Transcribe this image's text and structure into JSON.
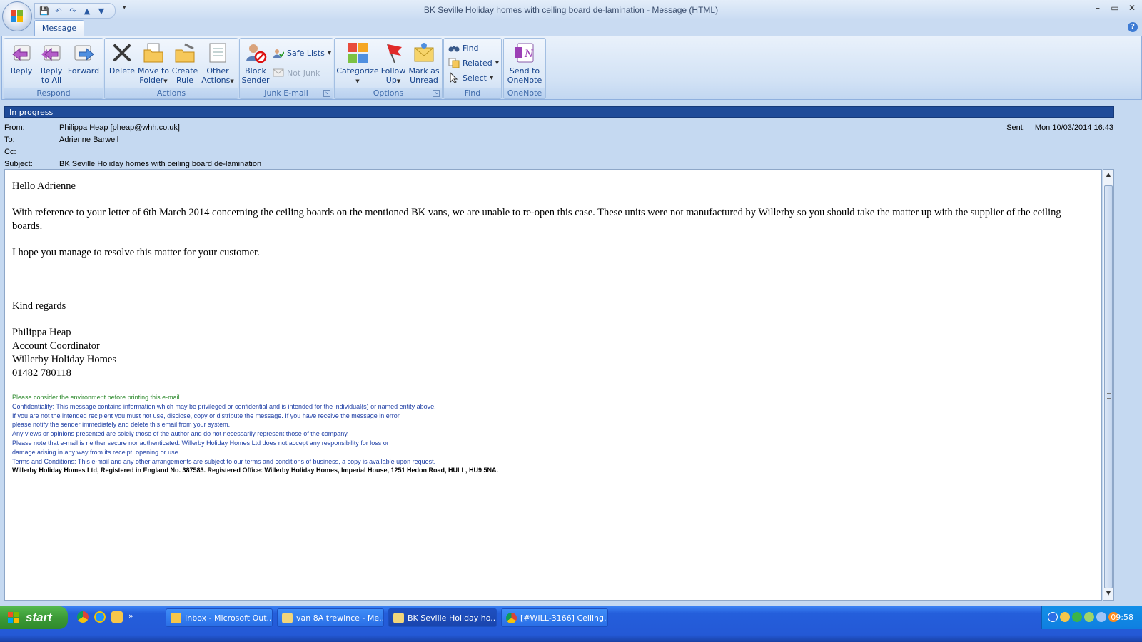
{
  "window": {
    "title": "BK Seville Holiday homes with ceiling board de-lamination - Message (HTML)",
    "controls": [
      "–",
      "▭",
      "✕"
    ]
  },
  "ribbon": {
    "tab": "Message",
    "groups": {
      "respond": {
        "label": "Respond",
        "reply": "Reply",
        "reply_all_1": "Reply",
        "reply_all_2": "to All",
        "forward": "Forward"
      },
      "actions": {
        "label": "Actions",
        "delete": "Delete",
        "move_1": "Move to",
        "move_2": "Folder",
        "rule_1": "Create",
        "rule_2": "Rule",
        "other_1": "Other",
        "other_2": "Actions"
      },
      "junk": {
        "label": "Junk E-mail",
        "block_1": "Block",
        "block_2": "Sender",
        "safe_lists": "Safe Lists",
        "not_junk": "Not Junk"
      },
      "options": {
        "label": "Options",
        "categorize": "Categorize",
        "follow_1": "Follow",
        "follow_2": "Up",
        "mark_1": "Mark as",
        "mark_2": "Unread"
      },
      "find": {
        "label": "Find",
        "find": "Find",
        "related": "Related",
        "select": "Select"
      },
      "onenote": {
        "label": "OneNote",
        "send_1": "Send to",
        "send_2": "OneNote"
      }
    }
  },
  "status_bar": "In progress",
  "header": {
    "from_label": "From:",
    "from": "Philippa Heap [pheap@whh.co.uk]",
    "to_label": "To:",
    "to": "Adrienne Barwell",
    "cc_label": "Cc:",
    "cc": "",
    "subject_label": "Subject:",
    "subject": "BK Seville Holiday homes with ceiling board de-lamination",
    "sent_label": "Sent:",
    "sent": "Mon 10/03/2014 16:43"
  },
  "body": {
    "greeting": "Hello Adrienne",
    "para1": "With reference to your letter of 6th March 2014 concerning the ceiling boards on the mentioned BK vans, we are unable to re-open this case.  These units were not manufactured by Willerby so you should take the matter up with the supplier of the ceiling boards.",
    "para2": "I hope you manage to resolve this matter for your customer.",
    "signoff": "Kind regards",
    "sig_name": "Philippa Heap",
    "sig_title": "Account Coordinator",
    "sig_company": "Willerby Holiday Homes",
    "sig_phone": "01482 780118",
    "disclaimer": [
      "Please consider the environment before printing this e-mail",
      "Confidentiality: This message contains information which may be privileged or confidential and is intended for the individual(s) or named entity above.",
      "If you are not the intended recipient you must not use, disclose, copy or distribute the message. If you have receive the message in error",
      "please notify the sender immediately and delete this email from your system.",
      "Any views or opinions presented are solely those of the author and do not necessarily represent those of the company.",
      "Please note that e-mail is neither secure nor authenticated. Willerby Holiday Homes Ltd does not accept any responsibility for loss or",
      "damage arising in any way from its receipt, opening or use.",
      "Terms and Conditions: This e-mail and any other arrangements are subject to our terms and conditions of business, a copy is available upon request.",
      "Willerby Holiday Homes Ltd, Registered in England No. 387583. Registered Office: Willerby Holiday Homes, Imperial House, 1251 Hedon Road, HULL, HU9 5NA."
    ]
  },
  "taskbar": {
    "start": "start",
    "tasks": [
      "Inbox - Microsoft Out...",
      "van 8A trewince - Me...",
      "BK Seville Holiday ho...",
      "[#WILL-3166] Ceiling..."
    ],
    "clock": "09:58",
    "overflow": "»"
  },
  "colors": {
    "status_bar": "#1f4b99",
    "ribbon_text": "#15428b",
    "disclaimer_blue": "#1f3fa5",
    "disclaimer_green": "#2d8a2d"
  }
}
